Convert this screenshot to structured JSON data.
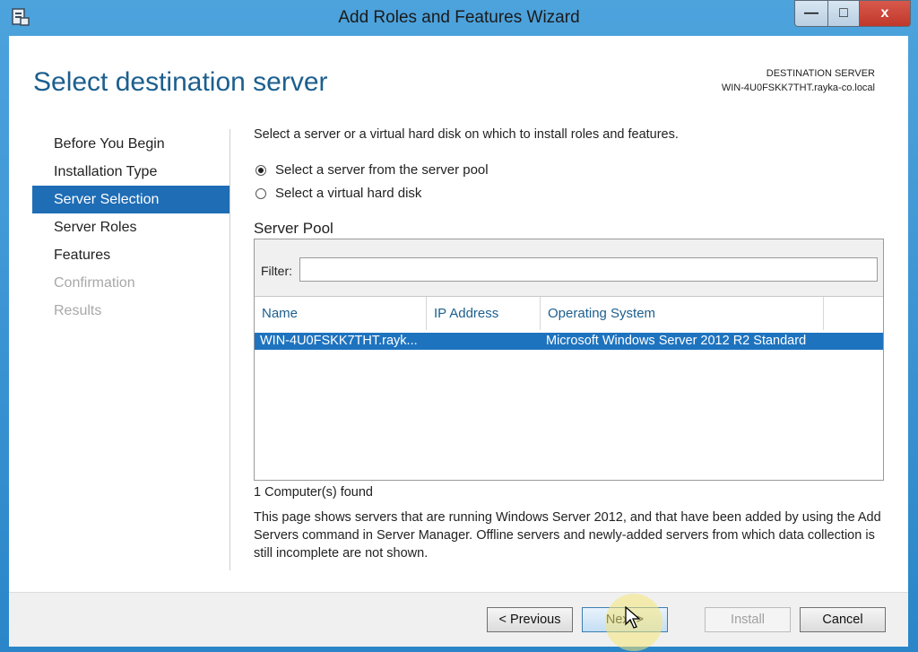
{
  "window": {
    "title": "Add Roles and Features Wizard",
    "minimize": "—",
    "maximize": "□",
    "close": "x"
  },
  "page": {
    "heading": "Select destination server",
    "dest_label": "DESTINATION SERVER",
    "dest_server": "WIN-4U0FSKK7THT.rayka-co.local"
  },
  "nav": {
    "items": [
      {
        "label": "Before You Begin"
      },
      {
        "label": "Installation Type"
      },
      {
        "label": "Server Selection"
      },
      {
        "label": "Server Roles"
      },
      {
        "label": "Features"
      },
      {
        "label": "Confirmation"
      },
      {
        "label": "Results"
      }
    ]
  },
  "main": {
    "intro": "Select a server or a virtual hard disk on which to install roles and features.",
    "option_pool": "Select a server from the server pool",
    "option_vhd": "Select a virtual hard disk",
    "pool_title": "Server Pool",
    "filter_label": "Filter:",
    "filter_value": "",
    "columns": [
      "Name",
      "IP Address",
      "Operating System"
    ],
    "rows": [
      {
        "name": "WIN-4U0FSKK7THT.rayk...",
        "ip": "",
        "os": "Microsoft Windows Server 2012 R2 Standard"
      }
    ],
    "found": "1 Computer(s) found",
    "description": "This page shows servers that are running Windows Server 2012, and that have been added by using the Add Servers command in Server Manager. Offline servers and newly-added servers from which data collection is still incomplete are not shown."
  },
  "footer": {
    "previous": "< Previous",
    "next": "Next >",
    "install": "Install",
    "cancel": "Cancel"
  }
}
